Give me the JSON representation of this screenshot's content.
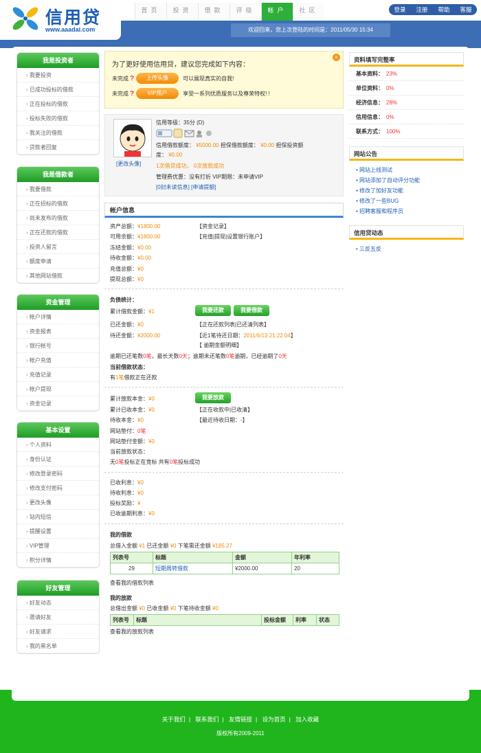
{
  "brand": {
    "title": "信用贷",
    "url": "www.aaadai.com",
    "accent": "#1d5fb3",
    "green": "#21b51d"
  },
  "nav": {
    "tabs": [
      "首页",
      "投资",
      "借款",
      "评级",
      "帐户",
      "社区"
    ],
    "active": 4
  },
  "toplinks": [
    "登录",
    "注册",
    "帮助",
    "客服"
  ],
  "welcome": "欢迎回来，您上次登陆的时间是：2011/05/30 15:34",
  "sidebar": [
    {
      "title": "我是投资者",
      "items": [
        "我要投资",
        "已成功投标的借款",
        "正在投标的借款",
        "投标失败的借款",
        "我关注的借款",
        "贷款者回复"
      ]
    },
    {
      "title": "我是借款者",
      "items": [
        "我要借款",
        "正在招标的借款",
        "尚未发布的借款",
        "正在还款的借款",
        "投资人留言",
        "额度申请",
        "其他网站借款"
      ]
    },
    {
      "title": "资金管理",
      "items": [
        "帐户详情",
        "资金报表",
        "银行帐号",
        "帐户充值",
        "充值记录",
        "帐户提现",
        "资金记录"
      ]
    },
    {
      "title": "基本设置",
      "items": [
        "个人资料",
        "身份认证",
        "修改登录密码",
        "修改支付密码",
        "更改头像",
        "站内短信",
        "提醒设置",
        "VIP管理",
        "积分详情"
      ]
    },
    {
      "title": "好友管理",
      "items": [
        "好友动态",
        "邀请好友",
        "好友请求",
        "我的黑名单"
      ]
    }
  ],
  "promo": {
    "title": "为了更好使用信用贷，建议您完成如下内容：",
    "rows": [
      {
        "status": "未完成",
        "button": "上传头像",
        "text": "可以展现真实的自我!"
      },
      {
        "status": "未完成",
        "button": "VIP用户",
        "text": "享受一系列优质服务以及尊荣特权! !"
      }
    ]
  },
  "profile": {
    "change_avatar": "[更改头像]",
    "level_label": "信用等级：",
    "level_value": "35分 (D)",
    "credit_label": "信用借款额度：",
    "credit_value": "¥5000.00",
    "guarantee_label": "担保借款额度：",
    "guarantee_value": "¥0.00",
    "invest_guarantee_label": "担保投资额",
    "invest_guarantee_label2": "度：",
    "invest_guarantee_value": "¥0.00",
    "borrow_success": "1次借贷成功，",
    "lend_success": "0次放款成功",
    "fee_line": "管理费优惠：没有打折  VIP期限：未申请VIP",
    "links": "[0封未读信息] [申请提额]"
  },
  "account": {
    "header": "帐户信息",
    "rows": [
      {
        "label": "资产总额：",
        "value": "¥1800.00",
        "link": "【资金记录】"
      },
      {
        "label": "可用余额：",
        "value": "¥1800.00",
        "link": "【充值|提现|设置银行账户】"
      },
      {
        "label": "冻结金额：",
        "value": "¥0.00",
        "link": ""
      },
      {
        "label": "待收金额：",
        "value": "¥0.00",
        "link": ""
      },
      {
        "label": "充值总额：",
        "value": "¥0",
        "link": ""
      },
      {
        "label": "提现总额：",
        "value": "¥0",
        "link": ""
      }
    ]
  },
  "debt": {
    "title": "负债统计：",
    "total_label": "累计借款金额：",
    "total_value": "¥1",
    "btn_repay": "我要还款",
    "btn_borrow": "我要借款",
    "repaid_label": "已还金额：",
    "repaid_value": "¥0",
    "repaid_link": "【正在还款列表|已还清列表】",
    "pending_label": "待还金额：",
    "pending_value": "¥2000.00",
    "due_label": "【近1笔待还日期：",
    "due_value": "2011/6/13 21:22:04",
    "due_end": "】",
    "overdue_link": "【  逾期金额明细】",
    "overdue_line_a": "逾期已还笔数",
    "overdue_line_b": "0笔",
    "overdue_line_c": "，最长天数",
    "overdue_line_d": "0天",
    "overdue_line_e": "；逾期未还笔数",
    "overdue_line_f": "0笔",
    "overdue_line_g": "逾期，已经逾期了",
    "overdue_line_h": "0天",
    "current_title": "当前借款状态：",
    "current_a": "有",
    "current_b": "1笔",
    "current_c": "借款正在还款"
  },
  "lend": {
    "total_label": "累计放款本金：",
    "total_value": "¥0",
    "btn_lend": "我要放款",
    "received_label": "累计已收本金：",
    "received_value": "¥0",
    "received_link": "【正在收款中|已收清】",
    "pending_label": "待收本金：",
    "pending_value": "¥0",
    "recent_label": "【最近待收日期：",
    "recent_value": "-",
    "recent_end": "】",
    "site_adv_label": "网站垫付：",
    "site_adv_value": "0笔",
    "site_adv_amount_label": "网站垫付金额：",
    "site_adv_amount_value": "¥0",
    "status_title": "当前放款状态：",
    "status_a": "无",
    "status_b": "0笔",
    "status_c": "投标正在竞标 共有",
    "status_d": "0笔",
    "status_e": "投标成功"
  },
  "interest": [
    {
      "label": "已收利息：",
      "value": "¥0"
    },
    {
      "label": "待收利息：",
      "value": "¥0"
    },
    {
      "label": "投标奖励：",
      "value": "¥"
    },
    {
      "label": "已收逾期利息：",
      "value": "¥0"
    }
  ],
  "my_loans": {
    "title": "我的借款",
    "summary_a": "总借入金额",
    "summary_b": "¥1",
    "summary_c": "已还金额",
    "summary_d": "¥0",
    "summary_e": "下笔需还金额",
    "summary_f": "¥185.27",
    "columns": [
      "列表号",
      "标题",
      "金额",
      "年利率"
    ],
    "rows": [
      [
        "29",
        "短期周转借款",
        "¥2000.00",
        "20"
      ]
    ],
    "more": "查看我的借款列表"
  },
  "my_lends": {
    "title": "我的放款",
    "summary_a": "总借出金额",
    "summary_b": "¥0",
    "summary_c": "已收金额",
    "summary_d": "¥0",
    "summary_e": "下笔待收金额",
    "summary_f": "¥0",
    "columns": [
      "列表号",
      "标题",
      "投标金额",
      "利率",
      "状态"
    ],
    "more": "查看我的放款列表"
  },
  "completeness": {
    "title": "资料填写完整率",
    "items": [
      {
        "label": "基本资料：",
        "value": "23%"
      },
      {
        "label": "单位资料：",
        "value": "0%"
      },
      {
        "label": "经济信息：",
        "value": "28%"
      },
      {
        "label": "信用信息：",
        "value": "0%"
      },
      {
        "label": "联系方式：",
        "value": "100%"
      }
    ]
  },
  "announcements": {
    "title": "网站公告",
    "items": [
      "网站上线测试",
      "网站添加了自动评分功能",
      "修改了加好友功能",
      "修改了一些BUG",
      "招聘客服和程序员"
    ]
  },
  "news": {
    "title": "信用贷动态",
    "items": [
      "三反五反"
    ]
  },
  "footer": {
    "links": [
      "关于我们",
      "联系我们",
      "友情链接",
      "设为首页",
      "加入收藏"
    ],
    "copyright": "版权所有2009-2011"
  }
}
